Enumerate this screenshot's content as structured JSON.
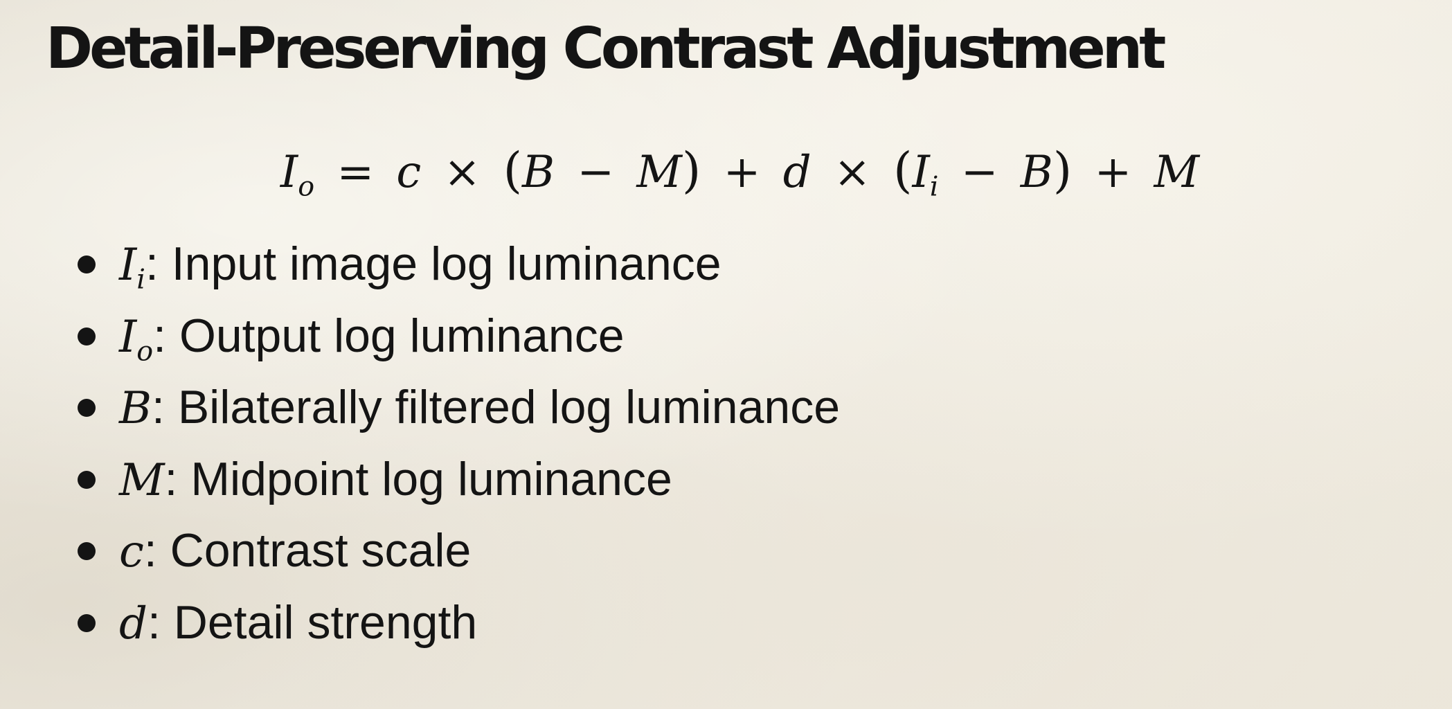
{
  "title": "Detail-Preserving Contrast Adjustment",
  "equation": {
    "I": "I",
    "o": "o",
    "i": "i",
    "equals": "=",
    "times": "×",
    "minus": "−",
    "plus": "+",
    "lparen": "(",
    "rparen": ")",
    "c": "c",
    "d": "d",
    "B": "B",
    "M": "M"
  },
  "legend": [
    {
      "symbol": "I",
      "subscript": "i",
      "text": ": Input image log luminance"
    },
    {
      "symbol": "I",
      "subscript": "o",
      "text": ": Output log luminance"
    },
    {
      "symbol": "B",
      "subscript": "",
      "text": ": Bilaterally filtered log luminance"
    },
    {
      "symbol": "M",
      "subscript": "",
      "text": ": Midpoint log luminance"
    },
    {
      "symbol": "c",
      "subscript": "",
      "text": ": Contrast scale"
    },
    {
      "symbol": "d",
      "subscript": "",
      "text": ": Detail strength"
    }
  ]
}
